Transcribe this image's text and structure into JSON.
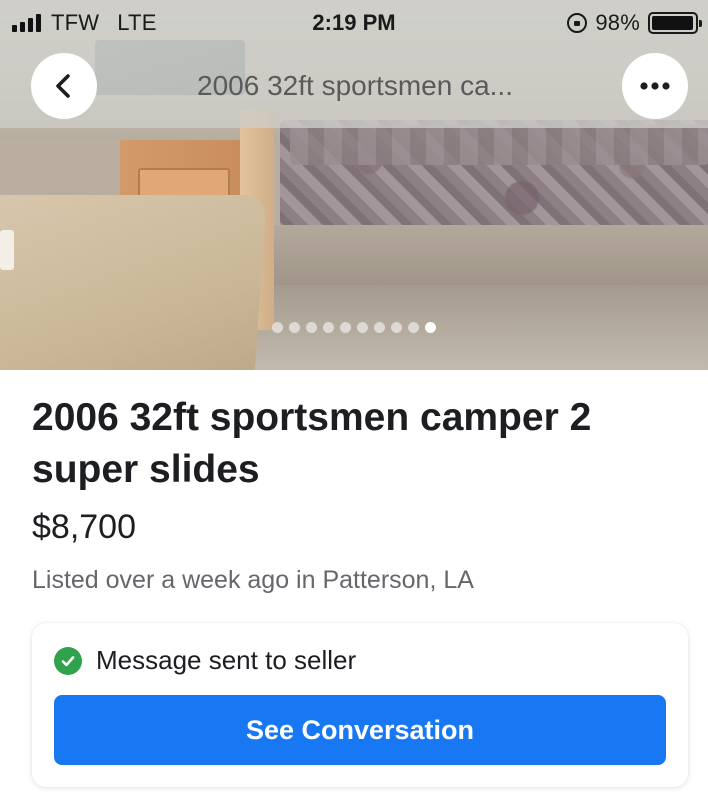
{
  "status_bar": {
    "carrier": "TFW",
    "network": "LTE",
    "time": "2:19 PM",
    "battery": "98%",
    "battery_level": 0.98
  },
  "nav": {
    "title": "2006 32ft sportsmen ca...",
    "back_icon": "chevron-left-icon",
    "more_icon": "ellipsis-icon"
  },
  "carousel": {
    "photo_count": 10,
    "active_index": 9
  },
  "listing": {
    "title": "2006 32ft sportsmen camper 2 super slides",
    "price": "$8,700",
    "meta": "Listed over a week ago in Patterson, LA"
  },
  "message_card": {
    "status": "Message sent to seller",
    "status_icon": "check-circle-icon",
    "button_label": "See Conversation",
    "accent_color": "#1877f2",
    "success_color": "#31a24c"
  }
}
